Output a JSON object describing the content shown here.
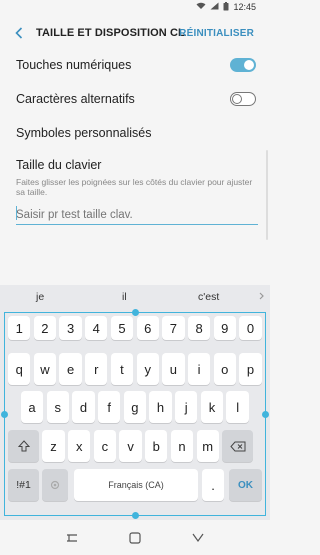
{
  "status_bar": {
    "time": "12:45",
    "icons": [
      "wifi-icon",
      "signal-icon",
      "battery-icon"
    ]
  },
  "header": {
    "title": "TAILLE ET DISPOSITION CL...",
    "reset_label": "RÉINITIALISER"
  },
  "settings": [
    {
      "label": "Touches numériques",
      "toggle": "on"
    },
    {
      "label": "Caractères alternatifs",
      "toggle": "off"
    },
    {
      "label": "Symboles personnalisés"
    }
  ],
  "keyboard_size": {
    "title": "Taille du clavier",
    "description": "Faites glisser les poignées sur les côtés du clavier pour ajuster sa taille.",
    "input_placeholder": "Saisir pr test taille clav."
  },
  "keyboard": {
    "suggestions": [
      "je",
      "il",
      "c'est"
    ],
    "row_numbers": [
      "1",
      "2",
      "3",
      "4",
      "5",
      "6",
      "7",
      "8",
      "9",
      "0"
    ],
    "row_1": [
      {
        "k": "q",
        "s": ""
      },
      {
        "k": "w",
        "s": ""
      },
      {
        "k": "e",
        "s": ""
      },
      {
        "k": "r",
        "s": ""
      },
      {
        "k": "t",
        "s": ""
      },
      {
        "k": "y",
        "s": ""
      },
      {
        "k": "u",
        "s": ""
      },
      {
        "k": "i",
        "s": ""
      },
      {
        "k": "o",
        "s": ""
      },
      {
        "k": "p",
        "s": ""
      }
    ],
    "row_2": [
      "a",
      "s",
      "d",
      "f",
      "g",
      "h",
      "j",
      "k",
      "l"
    ],
    "row_3": [
      "z",
      "x",
      "c",
      "v",
      "b",
      "n",
      "m"
    ],
    "symbols_label": "!#1",
    "space_label": "Français (CA)",
    "period_label": ".",
    "ok_label": "OK",
    "colors": {
      "accent": "#41b4dc",
      "toggle_on": "#5fb2d4",
      "link": "#3b8fbf"
    }
  },
  "navbar": {
    "buttons": [
      "recents-icon",
      "home-icon",
      "back-icon"
    ]
  }
}
